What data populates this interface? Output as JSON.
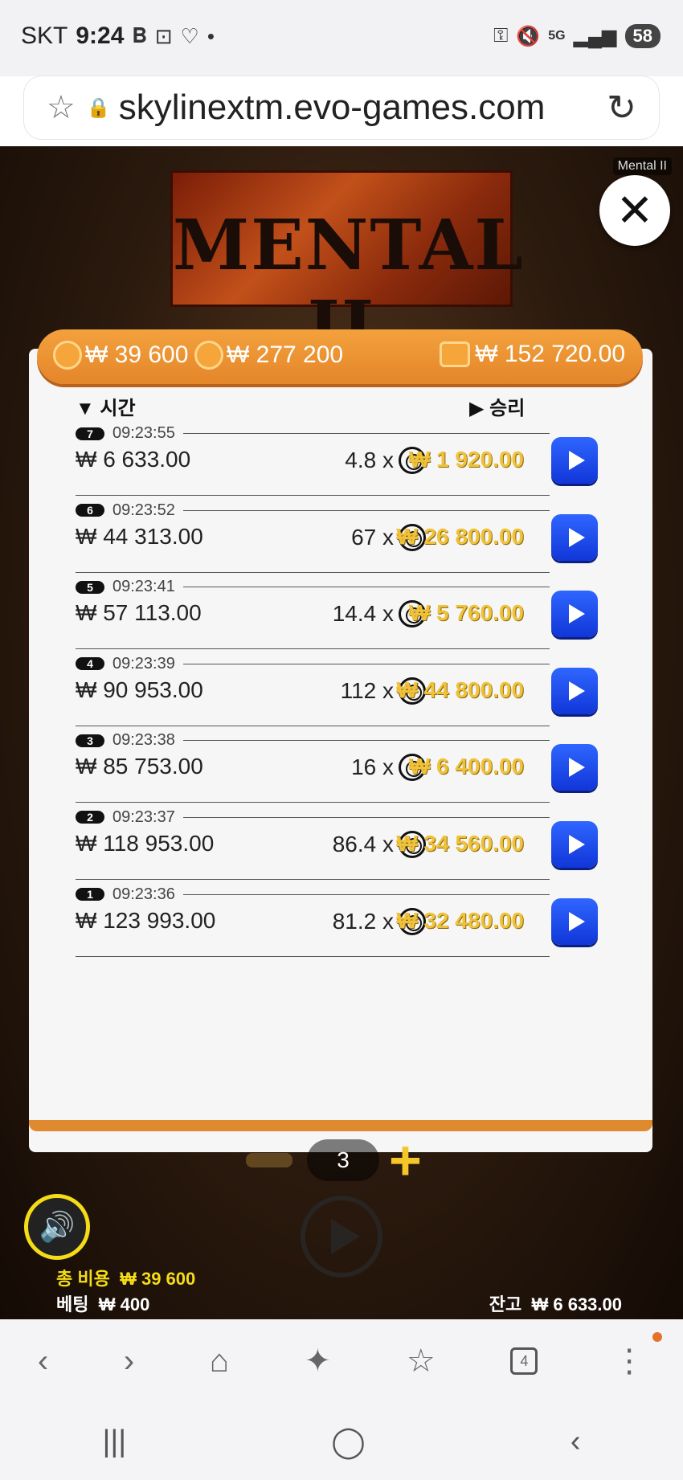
{
  "status": {
    "carrier": "SKT",
    "time": "9:24",
    "battery": "58",
    "network": "5G"
  },
  "browser": {
    "url": "skylinextm.evo-games.com",
    "tabs_count": "4"
  },
  "game": {
    "title": "Mental II",
    "logo_text": "MENTAL II",
    "header": {
      "bet_total": "₩ 39 600",
      "win_total": "₩ 277 200",
      "balance": "₩ 152 720.00"
    },
    "columns": {
      "time": "시간",
      "win": "승리"
    },
    "rows": [
      {
        "num": "7",
        "time": "09:23:55",
        "balance": "₩ 6 633.00",
        "mult": "4.8 x",
        "win": "₩ 1 920.00"
      },
      {
        "num": "6",
        "time": "09:23:52",
        "balance": "₩ 44 313.00",
        "mult": "67 x",
        "win": "₩ 26 800.00"
      },
      {
        "num": "5",
        "time": "09:23:41",
        "balance": "₩ 57 113.00",
        "mult": "14.4 x",
        "win": "₩ 5 760.00"
      },
      {
        "num": "4",
        "time": "09:23:39",
        "balance": "₩ 90 953.00",
        "mult": "112 x",
        "win": "₩ 44 800.00"
      },
      {
        "num": "3",
        "time": "09:23:38",
        "balance": "₩ 85 753.00",
        "mult": "16 x",
        "win": "₩ 6 400.00"
      },
      {
        "num": "2",
        "time": "09:23:37",
        "balance": "₩ 118 953.00",
        "mult": "86.4 x",
        "win": "₩ 34 560.00"
      },
      {
        "num": "1",
        "time": "09:23:36",
        "balance": "₩ 123 993.00",
        "mult": "81.2 x",
        "win": "₩ 32 480.00"
      }
    ],
    "stepper_value": "3",
    "footer": {
      "total_cost_label": "총 비용",
      "total_cost": "₩ 39 600",
      "bet_label": "베팅",
      "bet": "₩ 400",
      "balance_label": "잔고",
      "balance": "₩ 6 633.00"
    }
  }
}
